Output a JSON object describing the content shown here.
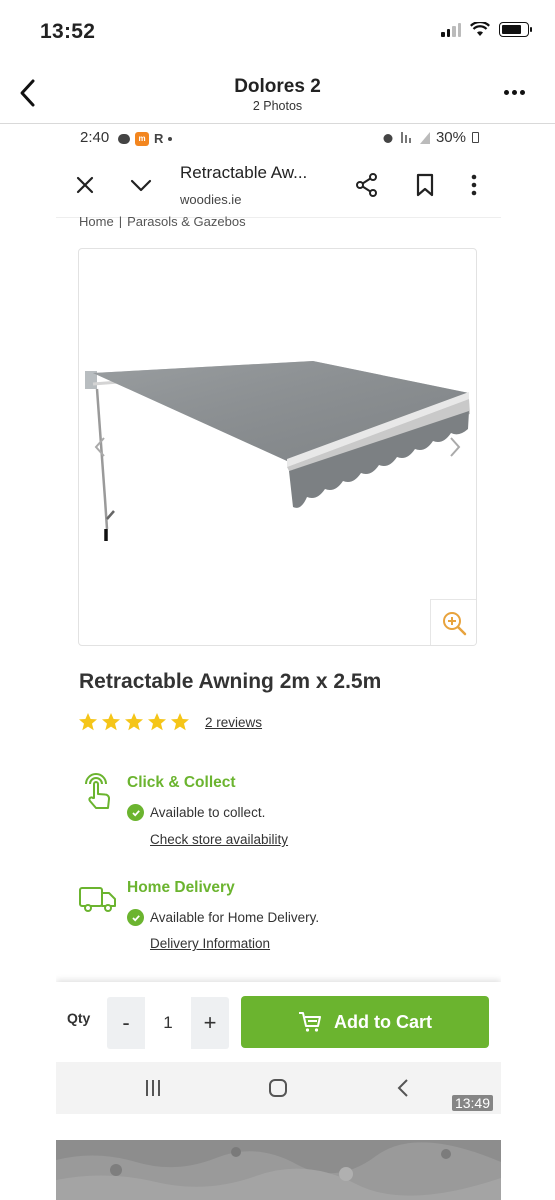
{
  "ios_status": {
    "time": "13:52"
  },
  "ios_nav": {
    "title": "Dolores 2",
    "subtitle": "2 Photos"
  },
  "android_status": {
    "time": "2:40",
    "app_badge": "m",
    "r_label": "R",
    "battery": "30%"
  },
  "browser": {
    "tab_title": "Retractable Aw...",
    "url": "woodies.ie"
  },
  "breadcrumb": {
    "home": "Home",
    "separator": "|",
    "category": "Parasols & Gazebos"
  },
  "product": {
    "title": "Retractable Awning 2m x 2.5m",
    "rating_stars": 5,
    "reviews": "2 reviews"
  },
  "click_collect": {
    "title": "Click & Collect",
    "status": "Available to collect.",
    "link": "Check store availability"
  },
  "home_delivery": {
    "title": "Home Delivery",
    "status": "Available for Home Delivery.",
    "link": "Delivery Information"
  },
  "cart": {
    "qty_label": "Qty",
    "minus": "-",
    "qty_value": "1",
    "plus": "+",
    "add_button": "Add to Cart"
  },
  "video": {
    "duration": "13:49"
  },
  "colors": {
    "accent_green": "#6bb42f",
    "star_yellow": "#f5c518",
    "zoom_orange": "#e8a33d"
  }
}
